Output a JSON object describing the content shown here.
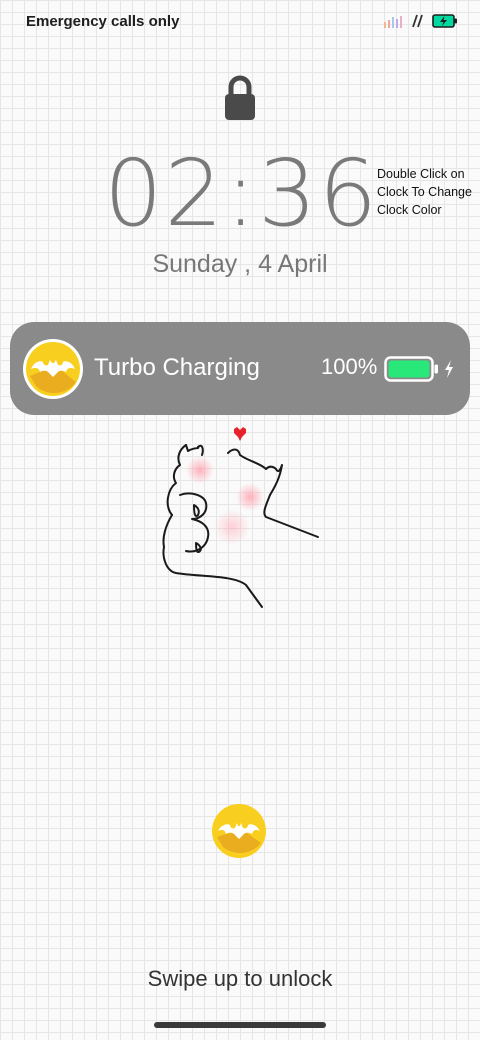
{
  "status_bar": {
    "carrier_text": "Emergency calls only",
    "icons": [
      "signal-bars-icon",
      "no-sim-icon",
      "battery-charging-icon"
    ],
    "battery_color": "#00d9a0"
  },
  "lockscreen": {
    "lock_icon": "padlock-icon",
    "clock": "02:36",
    "clock_hint": "Double Click on Clock To Change Clock Color",
    "date": "Sunday , 4 April",
    "unlock_text": "Swipe up to unlock"
  },
  "charging_card": {
    "title": "Turbo Charging",
    "percent": "100%",
    "battery_level": 1.0,
    "battery_color": "#28e87a",
    "background": "#8a8a8a",
    "avatar_icon": "bat-logo-icon"
  },
  "decoration": {
    "doodle": "hand-drawn-cat-doodle",
    "heart_color": "#e8222a"
  },
  "bottom_avatar_icon": "bat-logo-icon",
  "colors": {
    "avatar_yellow": "#f9cf1f",
    "avatar_shadow": "#e8a820",
    "clock_gray": "#7a7a7a"
  }
}
